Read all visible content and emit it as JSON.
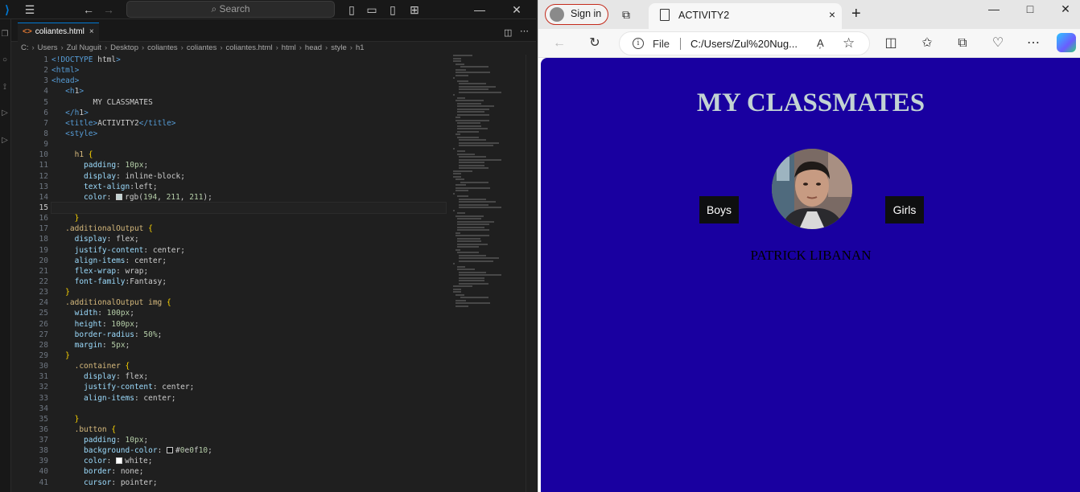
{
  "vscode": {
    "search_placeholder": "Search",
    "tab": {
      "filename": "coliantes.html",
      "close": "×"
    },
    "breadcrumb": [
      "C:",
      "Users",
      "Zul Nuguit",
      "Desktop",
      "coliantes",
      "coliantes",
      "coliantes.html",
      "html",
      "head",
      "style",
      "h1"
    ],
    "current_line": 15,
    "line_numbers": [
      "1",
      "2",
      "3",
      "4",
      "5",
      "6",
      "7",
      "8",
      "9",
      "10",
      "11",
      "12",
      "13",
      "14",
      "15",
      "16",
      "17",
      "18",
      "19",
      "20",
      "21",
      "22",
      "23",
      "24",
      "25",
      "26",
      "27",
      "28",
      "29",
      "30",
      "31",
      "32",
      "33",
      "34",
      "35",
      "36",
      "37",
      "38",
      "39",
      "40",
      "41"
    ],
    "code": [
      "<!DOCTYPE html>",
      "<html>",
      "<head>",
      "   <h1>",
      "         MY CLASSMATES",
      "   </h1>",
      "   <title>ACTIVITY2</title>",
      "   <style>",
      "",
      "     h1 {",
      "       padding: 10px;",
      "       display: inline-block;",
      "       text-align:left;",
      "       color: rgb(194, 211, 211);",
      "",
      "     }",
      "   .additionalOutput {",
      "     display: flex;",
      "     justify-content: center;",
      "     align-items: center;",
      "     flex-wrap: wrap;",
      "     font-family:Fantasy;",
      "   }",
      "   .additionalOutput img {",
      "     width: 100px;",
      "     height: 100px;",
      "     border-radius: 50%;",
      "     margin: 5px;",
      "   }",
      "     .container {",
      "       display: flex;",
      "       justify-content: center;",
      "       align-items: center;",
      "",
      "     }",
      "     .button {",
      "       padding: 10px;",
      "       background-color: #0e0f10;",
      "       color: white;",
      "       border: none;",
      "       cursor: pointer;"
    ],
    "swatch_colors": {
      "13": "#c2d3d3",
      "37": "#0e0f10",
      "38": "#ffffff"
    }
  },
  "browser": {
    "sign_in_label": "Sign in",
    "tab_title": "ACTIVITY2",
    "tab_close": "×",
    "new_tab": "+",
    "address_scheme": "File",
    "address_url": "C:/Users/Zul%20Nug...",
    "window_controls": {
      "minimize": "—",
      "maximize": "□",
      "close": "✕"
    }
  },
  "page": {
    "heading": "MY CLASSMATES",
    "left_button": "Boys",
    "right_button": "Girls",
    "name": "PATRICK LIBANAN",
    "background": "#1900a0",
    "heading_color": "rgb(194, 211, 211)"
  }
}
